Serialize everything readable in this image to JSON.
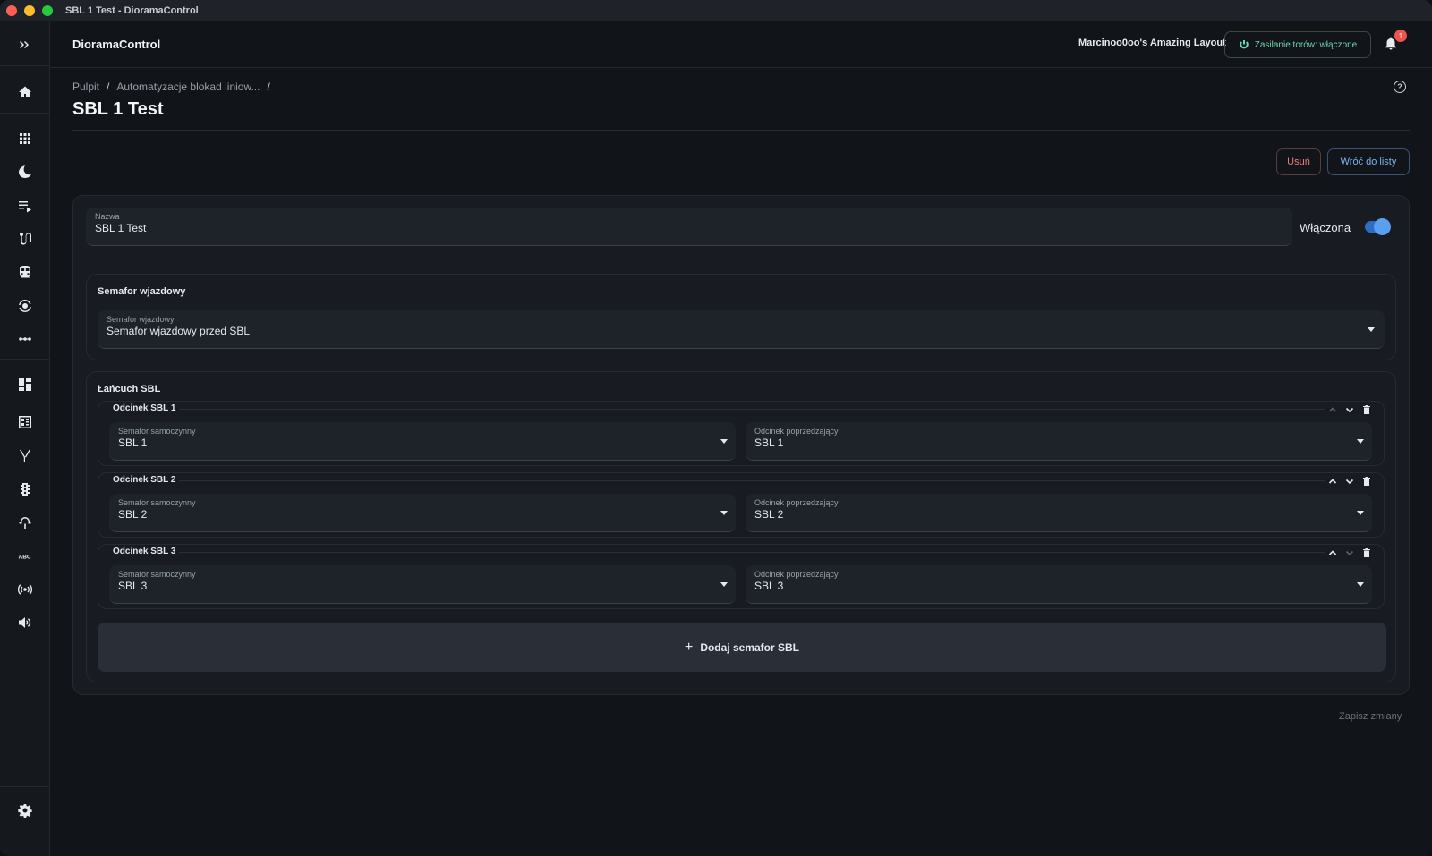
{
  "window": {
    "title": "SBL 1 Test - DioramaControl"
  },
  "topbar": {
    "app_name": "DioramaControl",
    "layout_name": "Marcinoo0oo's Amazing Layout",
    "power_label": "Zasilanie torów: włączone",
    "notification_count": "1"
  },
  "sidebar": {
    "icons": [
      "expand-icon",
      "home-icon",
      "grid-icon",
      "moon-icon",
      "playlist-icon",
      "route-icon",
      "train-icon",
      "automation-icon",
      "more-icon",
      "dashboard-icon",
      "panel-icon",
      "switch-icon",
      "traffic-light-icon",
      "crossing-icon",
      "abc-icon",
      "broadcast-icon",
      "speaker-icon",
      "settings-icon"
    ]
  },
  "breadcrumb": {
    "items": [
      "Pulpit",
      "Automatyzacje blokad liniow...",
      ""
    ],
    "sep": "/"
  },
  "page": {
    "title": "SBL 1 Test",
    "delete_label": "Usuń",
    "back_label": "Wróć do listy",
    "save_label": "Zapisz zmiany"
  },
  "form": {
    "name_label": "Nazwa",
    "name_value": "SBL 1 Test",
    "enabled_label": "Włączona",
    "enabled": true,
    "entry_section_title": "Semafor wjazdowy",
    "entry_field_label": "Semafor wjazdowy",
    "entry_field_value": "Semafor wjazdowy przed SBL",
    "chain_title": "Łańcuch SBL",
    "segments": [
      {
        "title": "Odcinek SBL 1",
        "semaphore_label": "Semafor samoczynny",
        "semaphore_value": "SBL 1",
        "previous_label": "Odcinek poprzedzający",
        "previous_value": "SBL 1"
      },
      {
        "title": "Odcinek SBL 2",
        "semaphore_label": "Semafor samoczynny",
        "semaphore_value": "SBL 2",
        "previous_label": "Odcinek poprzedzający",
        "previous_value": "SBL 2"
      },
      {
        "title": "Odcinek SBL 3",
        "semaphore_label": "Semafor samoczynny",
        "semaphore_value": "SBL 3",
        "previous_label": "Odcinek poprzedzający",
        "previous_value": "SBL 3"
      }
    ],
    "add_label": "Dodaj semafor SBL"
  },
  "colors": {
    "accent": "#2f6cc4",
    "power": "#69d8b0",
    "danger": "#f07b7b",
    "link": "#7fb2ee"
  }
}
